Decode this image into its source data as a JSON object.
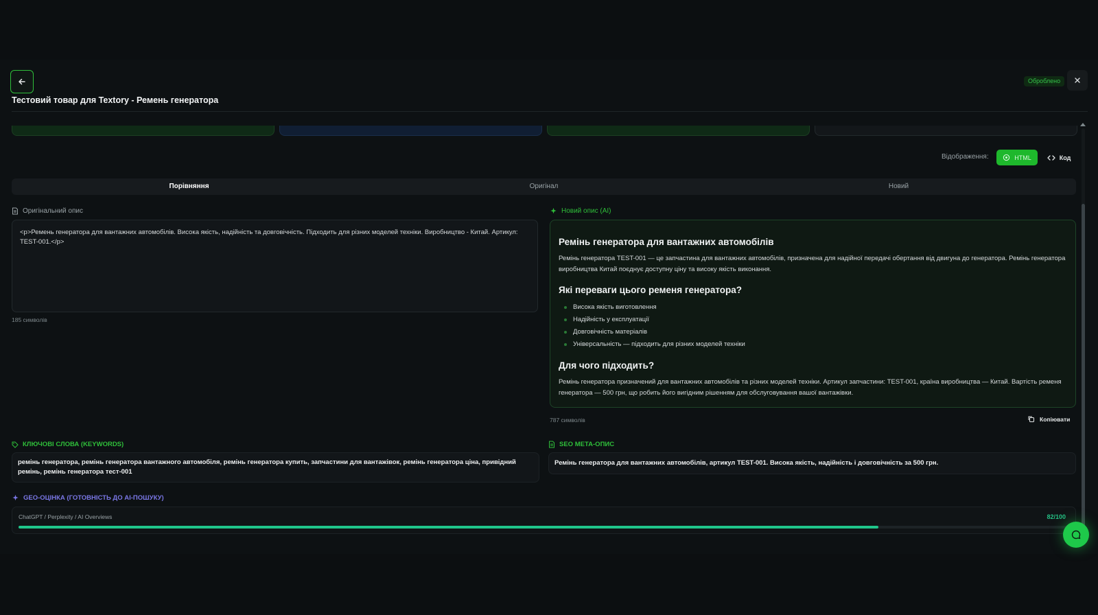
{
  "header": {
    "title": "Тестовий товар для Textory - Ремень генератора",
    "status_badge": "Оброблено"
  },
  "view_mode": {
    "label": "Відображення:",
    "html_label": "HTML",
    "code_label": "Код",
    "active": "HTML"
  },
  "tabs": [
    {
      "label": "Порівняння",
      "active": true
    },
    {
      "label": "Оригінал",
      "active": false
    },
    {
      "label": "Новий",
      "active": false
    }
  ],
  "original": {
    "label": "Оригінальний опис",
    "text": "<p>Ремень генератора для вантажних автомобілів. Висока якість, надійність та довговічність. Підходить для різних моделей техніки. Виробництво - Китай. Артикул: TEST-001.</p>",
    "char_count": "185 символів"
  },
  "new_description": {
    "label": "Новий опис (AI)",
    "heading1": "Ремінь генератора для вантажних автомобілів",
    "para1": "Ремінь генератора TEST-001 — це запчастина для вантажних автомобілів, призначена для надійної передачі обертання від двигуна до генератора. Ремінь генератора виробництва Китай поєднує доступну ціну та високу якість виконання.",
    "heading2": "Які переваги цього ременя генератора?",
    "bullets": [
      "Висока якість виготовлення",
      "Надійність у експлуатації",
      "Довговічність матеріалів",
      "Універсальність — підходить для різних моделей техніки"
    ],
    "heading3": "Для чого підходить?",
    "para2": "Ремінь генератора призначений для вантажних автомобілів та різних моделей техніки. Артикул запчастини: TEST-001, країна виробництва — Китай. Вартість ременя генератора — 500 грн, що робить його вигідним рішенням для обслуговування вашої вантажівки.",
    "char_count": "787 символів",
    "copy_label": "Копіювати"
  },
  "keywords": {
    "label": "КЛЮЧОВІ СЛОВА (KEYWORDS)",
    "text": "ремінь генератора, ремінь генератора вантажного автомобіля, ремінь генератора купить, запчастини для вантажівок, ремінь генератора ціна, привідний ремінь, ремінь генератора тест-001"
  },
  "seo_meta": {
    "label": "SEO МЕТА-ОПИС",
    "text": "Ремінь генератора для вантажних автомобілів, артикул TEST-001. Висока якість, надійність і довговічність за 500 грн."
  },
  "geo": {
    "label": "GEO-ОЦІНКА (ГОТОВНІСТЬ ДО AI-ПОШУКУ)",
    "sources": "ChatGPT / Perplexity / AI Overviews",
    "score_text": "82/100",
    "score": 82,
    "max": 100
  },
  "colors": {
    "accent_green": "#1eb82c",
    "geo_purple": "#7a77e6",
    "progress_teal": "#1fc58a"
  },
  "icons": [
    "arrow-left-icon",
    "close-icon",
    "eye-icon",
    "code-icon",
    "document-icon",
    "sparkles-icon",
    "tag-icon",
    "copy-icon",
    "chat-icon"
  ]
}
